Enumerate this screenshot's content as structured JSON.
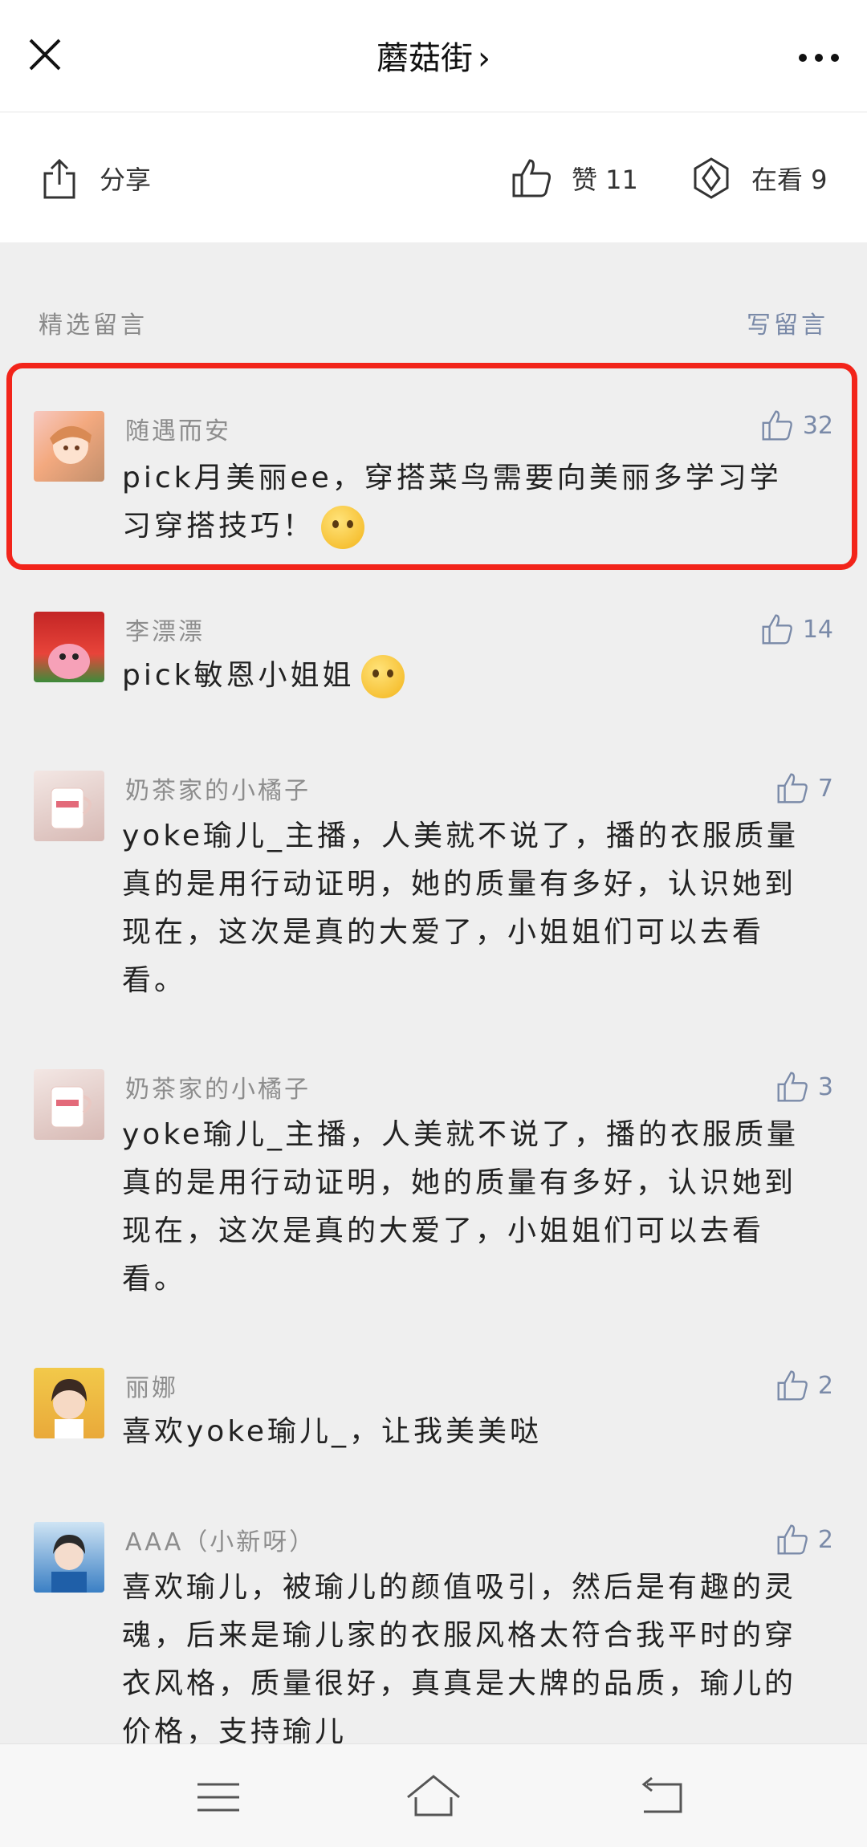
{
  "header": {
    "title": "蘑菇街",
    "title_chevron": "›",
    "close_icon": "close-icon",
    "more_icon": "more-icon"
  },
  "actions": {
    "share_label": "分享",
    "like_label": "赞 11",
    "watch_label": "在看 9"
  },
  "section": {
    "title": "精选留言",
    "write_label": "写留言"
  },
  "comments": [
    {
      "nickname": "随遇而安",
      "text": "pick月美丽ee，穿搭菜鸟需要向美丽多学习学习穿搭技巧！",
      "likes": "32",
      "emoji": "winking-face-emoji"
    },
    {
      "nickname": "李漂漂",
      "text": "pick敏恩小姐姐",
      "likes": "14",
      "emoji": "thinking-face-emoji"
    },
    {
      "nickname": "奶茶家的小橘子",
      "text": "yoke瑜儿_主播，人美就不说了，播的衣服质量真的是用行动证明，她的质量有多好，认识她到现在，这次是真的大爱了，小姐姐们可以去看看。",
      "likes": "7"
    },
    {
      "nickname": "奶茶家的小橘子",
      "text": "yoke瑜儿_主播，人美就不说了，播的衣服质量真的是用行动证明，她的质量有多好，认识她到现在，这次是真的大爱了，小姐姐们可以去看看。",
      "likes": "3"
    },
    {
      "nickname": "丽娜",
      "text": "喜欢yoke瑜儿_，让我美美哒",
      "likes": "2"
    },
    {
      "nickname": "AAA（小新呀）",
      "text": "喜欢瑜儿，被瑜儿的颜值吸引，然后是有趣的灵魂，后来是瑜儿家的衣服风格太符合我平时的穿衣风格，质量很好，真真是大牌的品质，瑜儿的价格，支持瑜儿",
      "likes": "2"
    }
  ],
  "colors": {
    "highlight_border": "#f2241a",
    "link_blue": "#7a8aa8",
    "background": "#efefef"
  },
  "navbar": {
    "menu_icon": "menu-icon",
    "home_icon": "home-icon",
    "back_icon": "back-icon"
  }
}
